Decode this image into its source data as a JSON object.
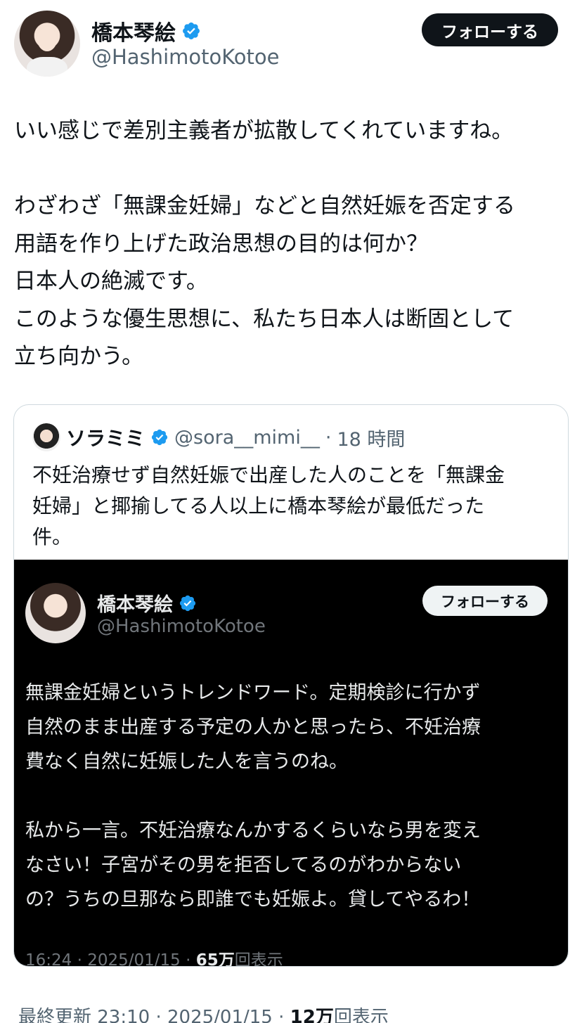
{
  "author": {
    "display_name": "橋本琴絵",
    "handle": "@HashimotoKotoe",
    "follow_label": "フォローする"
  },
  "tweet": {
    "text": "いい感じで差別主義者が拡散してくれていますね。\n\nわざわざ「無課金妊婦」などと自然妊娠を否定する\n用語を作り上げた政治思想の目的は何か？\n日本人の絶滅です。\nこのような優生思想に、私たち日本人は断固として\n立ち向かう。"
  },
  "quote": {
    "display_name": "ソラミミ",
    "handle": "@sora__mimi__",
    "separator": "·",
    "time": "18 時間",
    "text": "不妊治療せず自然妊娠で出産した人のことを「無課金\n妊婦」と揶揄してる人以上に橋本琴絵が最低だった\n件。",
    "screenshot": {
      "display_name": "橋本琴絵",
      "handle": "@HashimotoKotoe",
      "follow_label": "フォローする",
      "text": "無課金妊婦というトレンドワード。定期検診に行かず\n自然のまま出産する予定の人かと思ったら、不妊治療\n費なく自然に妊娠した人を言うのね。\n\n私から一言。不妊治療なんかするくらいなら男を変え\nなさい！子宮がその男を拒否してるのがわからない\nの？うちの旦那なら即誰でも妊娠よ。貸してやるわ！",
      "meta_prefix": "16:24 · 2025/01/15 · ",
      "views_count": "65万",
      "views_suffix": "回表示"
    }
  },
  "footer": {
    "meta_prefix": "最終更新 23:10 · 2025/01/15 · ",
    "views_count": "12万",
    "views_suffix": "回表示"
  },
  "colors": {
    "verified": "#1d9bf0",
    "text_primary": "#0f1419",
    "text_secondary": "#536471",
    "dark_bg": "#000000"
  }
}
